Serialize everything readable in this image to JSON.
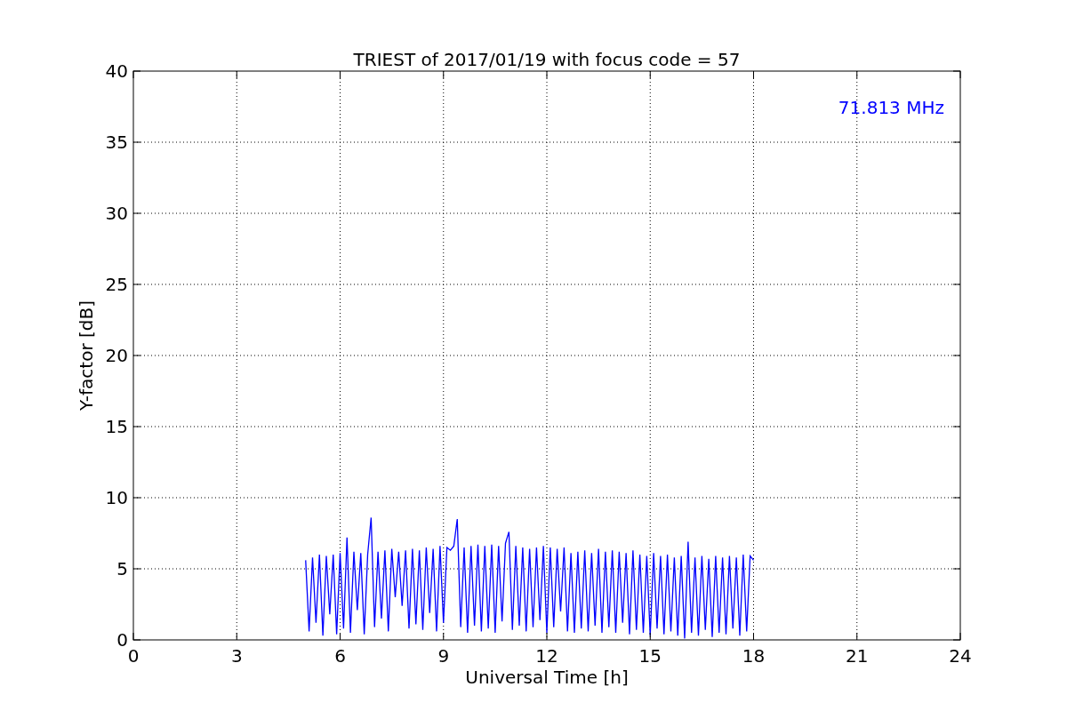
{
  "figure": {
    "chart_data": {
      "type": "line",
      "title": "TRIEST of 2017/01/19 with focus code = 57",
      "xlabel": "Universal Time [h]",
      "ylabel": "Y-factor [dB]",
      "x": [
        5.0,
        5.1,
        5.2,
        5.3,
        5.4,
        5.5,
        5.6,
        5.7,
        5.8,
        5.9,
        6.0,
        6.1,
        6.2,
        6.3,
        6.4,
        6.5,
        6.6,
        6.7,
        6.8,
        6.9,
        7.0,
        7.1,
        7.2,
        7.3,
        7.4,
        7.5,
        7.6,
        7.7,
        7.8,
        7.9,
        8.0,
        8.1,
        8.2,
        8.3,
        8.4,
        8.5,
        8.6,
        8.7,
        8.8,
        8.9,
        9.0,
        9.1,
        9.2,
        9.3,
        9.4,
        9.5,
        9.6,
        9.7,
        9.8,
        9.9,
        10.0,
        10.1,
        10.2,
        10.3,
        10.4,
        10.5,
        10.6,
        10.7,
        10.8,
        10.9,
        11.0,
        11.1,
        11.2,
        11.3,
        11.4,
        11.5,
        11.6,
        11.7,
        11.8,
        11.9,
        12.0,
        12.1,
        12.2,
        12.3,
        12.4,
        12.5,
        12.6,
        12.7,
        12.8,
        12.9,
        13.0,
        13.1,
        13.2,
        13.3,
        13.4,
        13.5,
        13.6,
        13.7,
        13.8,
        13.9,
        14.0,
        14.1,
        14.2,
        14.3,
        14.4,
        14.5,
        14.6,
        14.7,
        14.8,
        14.9,
        15.0,
        15.1,
        15.2,
        15.3,
        15.4,
        15.5,
        15.6,
        15.7,
        15.8,
        15.9,
        16.0,
        16.1,
        16.2,
        16.3,
        16.4,
        16.5,
        16.6,
        16.7,
        16.8,
        16.9,
        17.0,
        17.1,
        17.2,
        17.3,
        17.4,
        17.5,
        17.6,
        17.7,
        17.8,
        17.9,
        18.0
      ],
      "series": [
        {
          "color": "#0000ff",
          "values": [
            5.6,
            0.6,
            5.8,
            1.2,
            6.0,
            0.3,
            5.9,
            1.8,
            6.0,
            0.4,
            6.1,
            0.8,
            7.2,
            0.5,
            6.2,
            2.1,
            6.1,
            0.4,
            6.0,
            8.6,
            0.9,
            6.2,
            1.5,
            6.3,
            0.6,
            6.4,
            3.0,
            6.2,
            2.4,
            6.3,
            0.8,
            6.4,
            1.1,
            6.3,
            0.7,
            6.5,
            1.9,
            6.4,
            0.6,
            6.6,
            1.2,
            6.5,
            6.3,
            6.6,
            8.5,
            0.9,
            6.5,
            0.5,
            6.6,
            1.0,
            6.7,
            0.6,
            6.6,
            0.8,
            6.7,
            0.5,
            6.6,
            1.3,
            6.8,
            7.6,
            0.7,
            6.6,
            1.0,
            6.5,
            0.6,
            6.4,
            0.9,
            6.5,
            1.4,
            6.6,
            0.5,
            6.5,
            0.9,
            6.4,
            2.0,
            6.5,
            0.6,
            6.1,
            0.5,
            6.2,
            0.8,
            6.3,
            0.6,
            6.1,
            1.0,
            6.4,
            0.5,
            6.2,
            0.9,
            6.3,
            0.5,
            6.2,
            1.2,
            6.1,
            0.4,
            6.3,
            0.7,
            6.0,
            0.5,
            5.9,
            0.3,
            6.1,
            0.8,
            5.9,
            0.4,
            6.0,
            0.6,
            5.8,
            0.3,
            5.9,
            0.1,
            6.9,
            0.5,
            5.8,
            0.3,
            5.9,
            0.7,
            5.7,
            0.2,
            5.9,
            0.5,
            5.8,
            0.4,
            5.9,
            0.8,
            5.8,
            0.3,
            6.0,
            0.6,
            5.9,
            5.6
          ]
        }
      ],
      "xlim": [
        0,
        24
      ],
      "ylim": [
        0,
        40
      ],
      "xticks": [
        0,
        3,
        6,
        9,
        12,
        15,
        18,
        21,
        24
      ],
      "yticks": [
        0,
        5,
        10,
        15,
        20,
        25,
        30,
        35,
        40
      ],
      "grid": true,
      "annotations": [
        "71.813 MHz"
      ]
    }
  }
}
